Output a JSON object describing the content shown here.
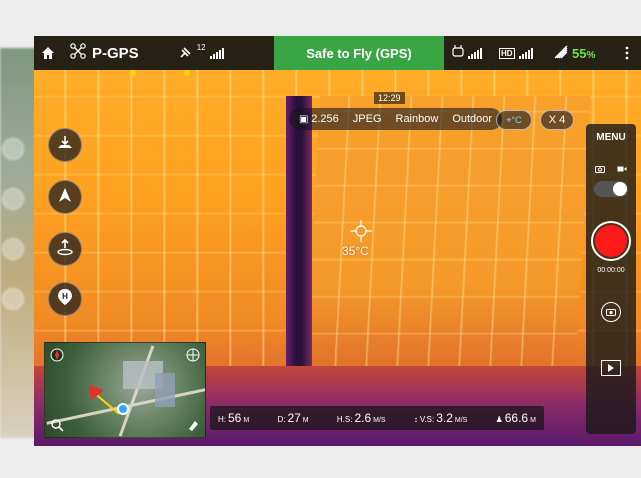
{
  "top_bar": {
    "flight_mode": "P-GPS",
    "gps_count": "12",
    "status": "Safe to Fly (GPS)",
    "battery_pct": "55",
    "battery_pct_suffix": "%",
    "hd_label": "HD",
    "time": "12:29"
  },
  "camera": {
    "aperture": "2.256",
    "format": "JPEG",
    "palette": "Rainbow",
    "scene": "Outdoor",
    "temp_mode": "⌖°C",
    "zoom": "X 4"
  },
  "spot_meter": {
    "value": "35°C"
  },
  "right_panel": {
    "menu_label": "MENU",
    "rec_time": "00:00:00"
  },
  "telemetry": {
    "h_label": "H:",
    "h_value": "56",
    "h_unit": "M",
    "d_label": "D:",
    "d_value": "27",
    "d_unit": "M",
    "hs_label": "H.S:",
    "hs_value": "2.6",
    "hs_unit": "M/S",
    "vs_label": "V.S:",
    "vs_value": "3.2",
    "vs_unit": "M/S",
    "alt_value": "66.6",
    "alt_unit": "M"
  },
  "colors": {
    "status_green": "#3aa545",
    "battery_green": "#6be34a",
    "record_red": "#ff1a1a"
  },
  "icons": {
    "home": "home-icon",
    "drone": "drone-icon",
    "satellite": "satellite-icon",
    "rc": "remote-controller-icon",
    "battery": "battery-icon",
    "takeoff": "takeoff-icon",
    "navigation": "navigation-arrow-icon",
    "landing": "landing-icon",
    "return_home": "return-home-icon",
    "camera": "camera-icon",
    "video": "video-icon",
    "settings": "settings-icon",
    "playback": "playback-icon"
  }
}
